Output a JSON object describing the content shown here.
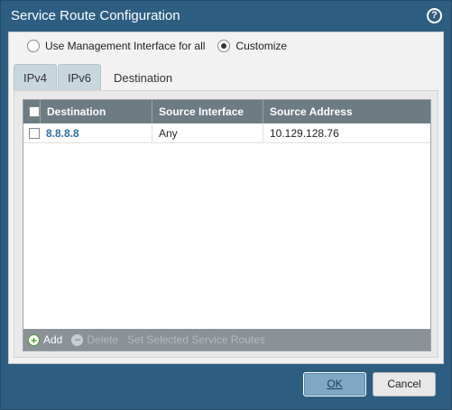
{
  "dialog": {
    "title": "Service Route Configuration",
    "help_icon": "question-circle-icon"
  },
  "mode": {
    "options": [
      {
        "label": "Use Management Interface for all",
        "selected": false
      },
      {
        "label": "Customize",
        "selected": true
      }
    ]
  },
  "tabs": [
    {
      "label": "IPv4",
      "active": false
    },
    {
      "label": "IPv6",
      "active": false
    },
    {
      "label": "Destination",
      "active": true
    }
  ],
  "grid": {
    "columns": [
      "Destination",
      "Source Interface",
      "Source Address"
    ],
    "rows": [
      {
        "destination": "8.8.8.8",
        "source_interface": "Any",
        "source_address": "10.129.128.76",
        "checked": false
      }
    ]
  },
  "toolbar": {
    "add_label": "Add",
    "delete_label": "Delete",
    "set_selected_label": "Set Selected Service Routes"
  },
  "footer": {
    "ok_label": "OK",
    "cancel_label": "Cancel"
  },
  "colors": {
    "titlebar": "#2e5d82",
    "grid_header": "#6d7b83",
    "link": "#2f6fa3"
  }
}
